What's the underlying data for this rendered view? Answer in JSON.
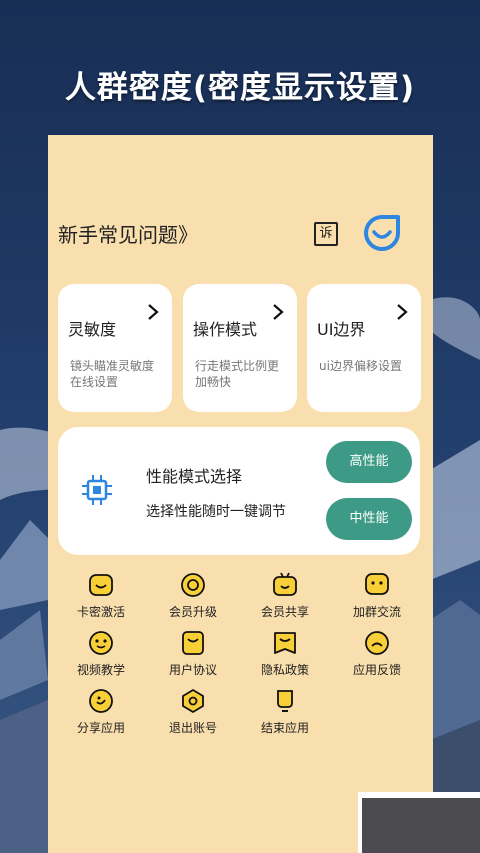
{
  "headline": "人群密度(密度显示设置)",
  "faq": "新手常见问题》",
  "report_label": "诉",
  "cards": [
    {
      "title": "灵敏度",
      "desc": "镜头瞄准灵敏度在线设置"
    },
    {
      "title": "操作模式",
      "desc": "行走模式比例更加畅快"
    },
    {
      "title": "UI边界",
      "desc": "ui边界偏移设置"
    }
  ],
  "performance": {
    "title": "性能模式选择",
    "desc": "选择性能随时一键调节",
    "high": "高性能",
    "mid": "中性能"
  },
  "grid": [
    {
      "label": "卡密激活",
      "icon": "smile-box-icon"
    },
    {
      "label": "会员升级",
      "icon": "target-circle-icon"
    },
    {
      "label": "会员共享",
      "icon": "tv-face-icon"
    },
    {
      "label": "加群交流",
      "icon": "chat-face-icon"
    },
    {
      "label": "视频教学",
      "icon": "face-circle-icon"
    },
    {
      "label": "用户协议",
      "icon": "agreement-icon"
    },
    {
      "label": "隐私政策",
      "icon": "privacy-icon"
    },
    {
      "label": "应用反馈",
      "icon": "feedback-face-icon"
    },
    {
      "label": "分享应用",
      "icon": "share-icon"
    },
    {
      "label": "退出账号",
      "icon": "logout-icon"
    },
    {
      "label": "结束应用",
      "icon": "bulb-icon"
    }
  ],
  "colors": {
    "accent": "#3d9a86",
    "panel": "#f9dfad",
    "icon_fill": "#f9cf37",
    "sky": "#1b3560",
    "smile_blue": "#2f86e0"
  }
}
